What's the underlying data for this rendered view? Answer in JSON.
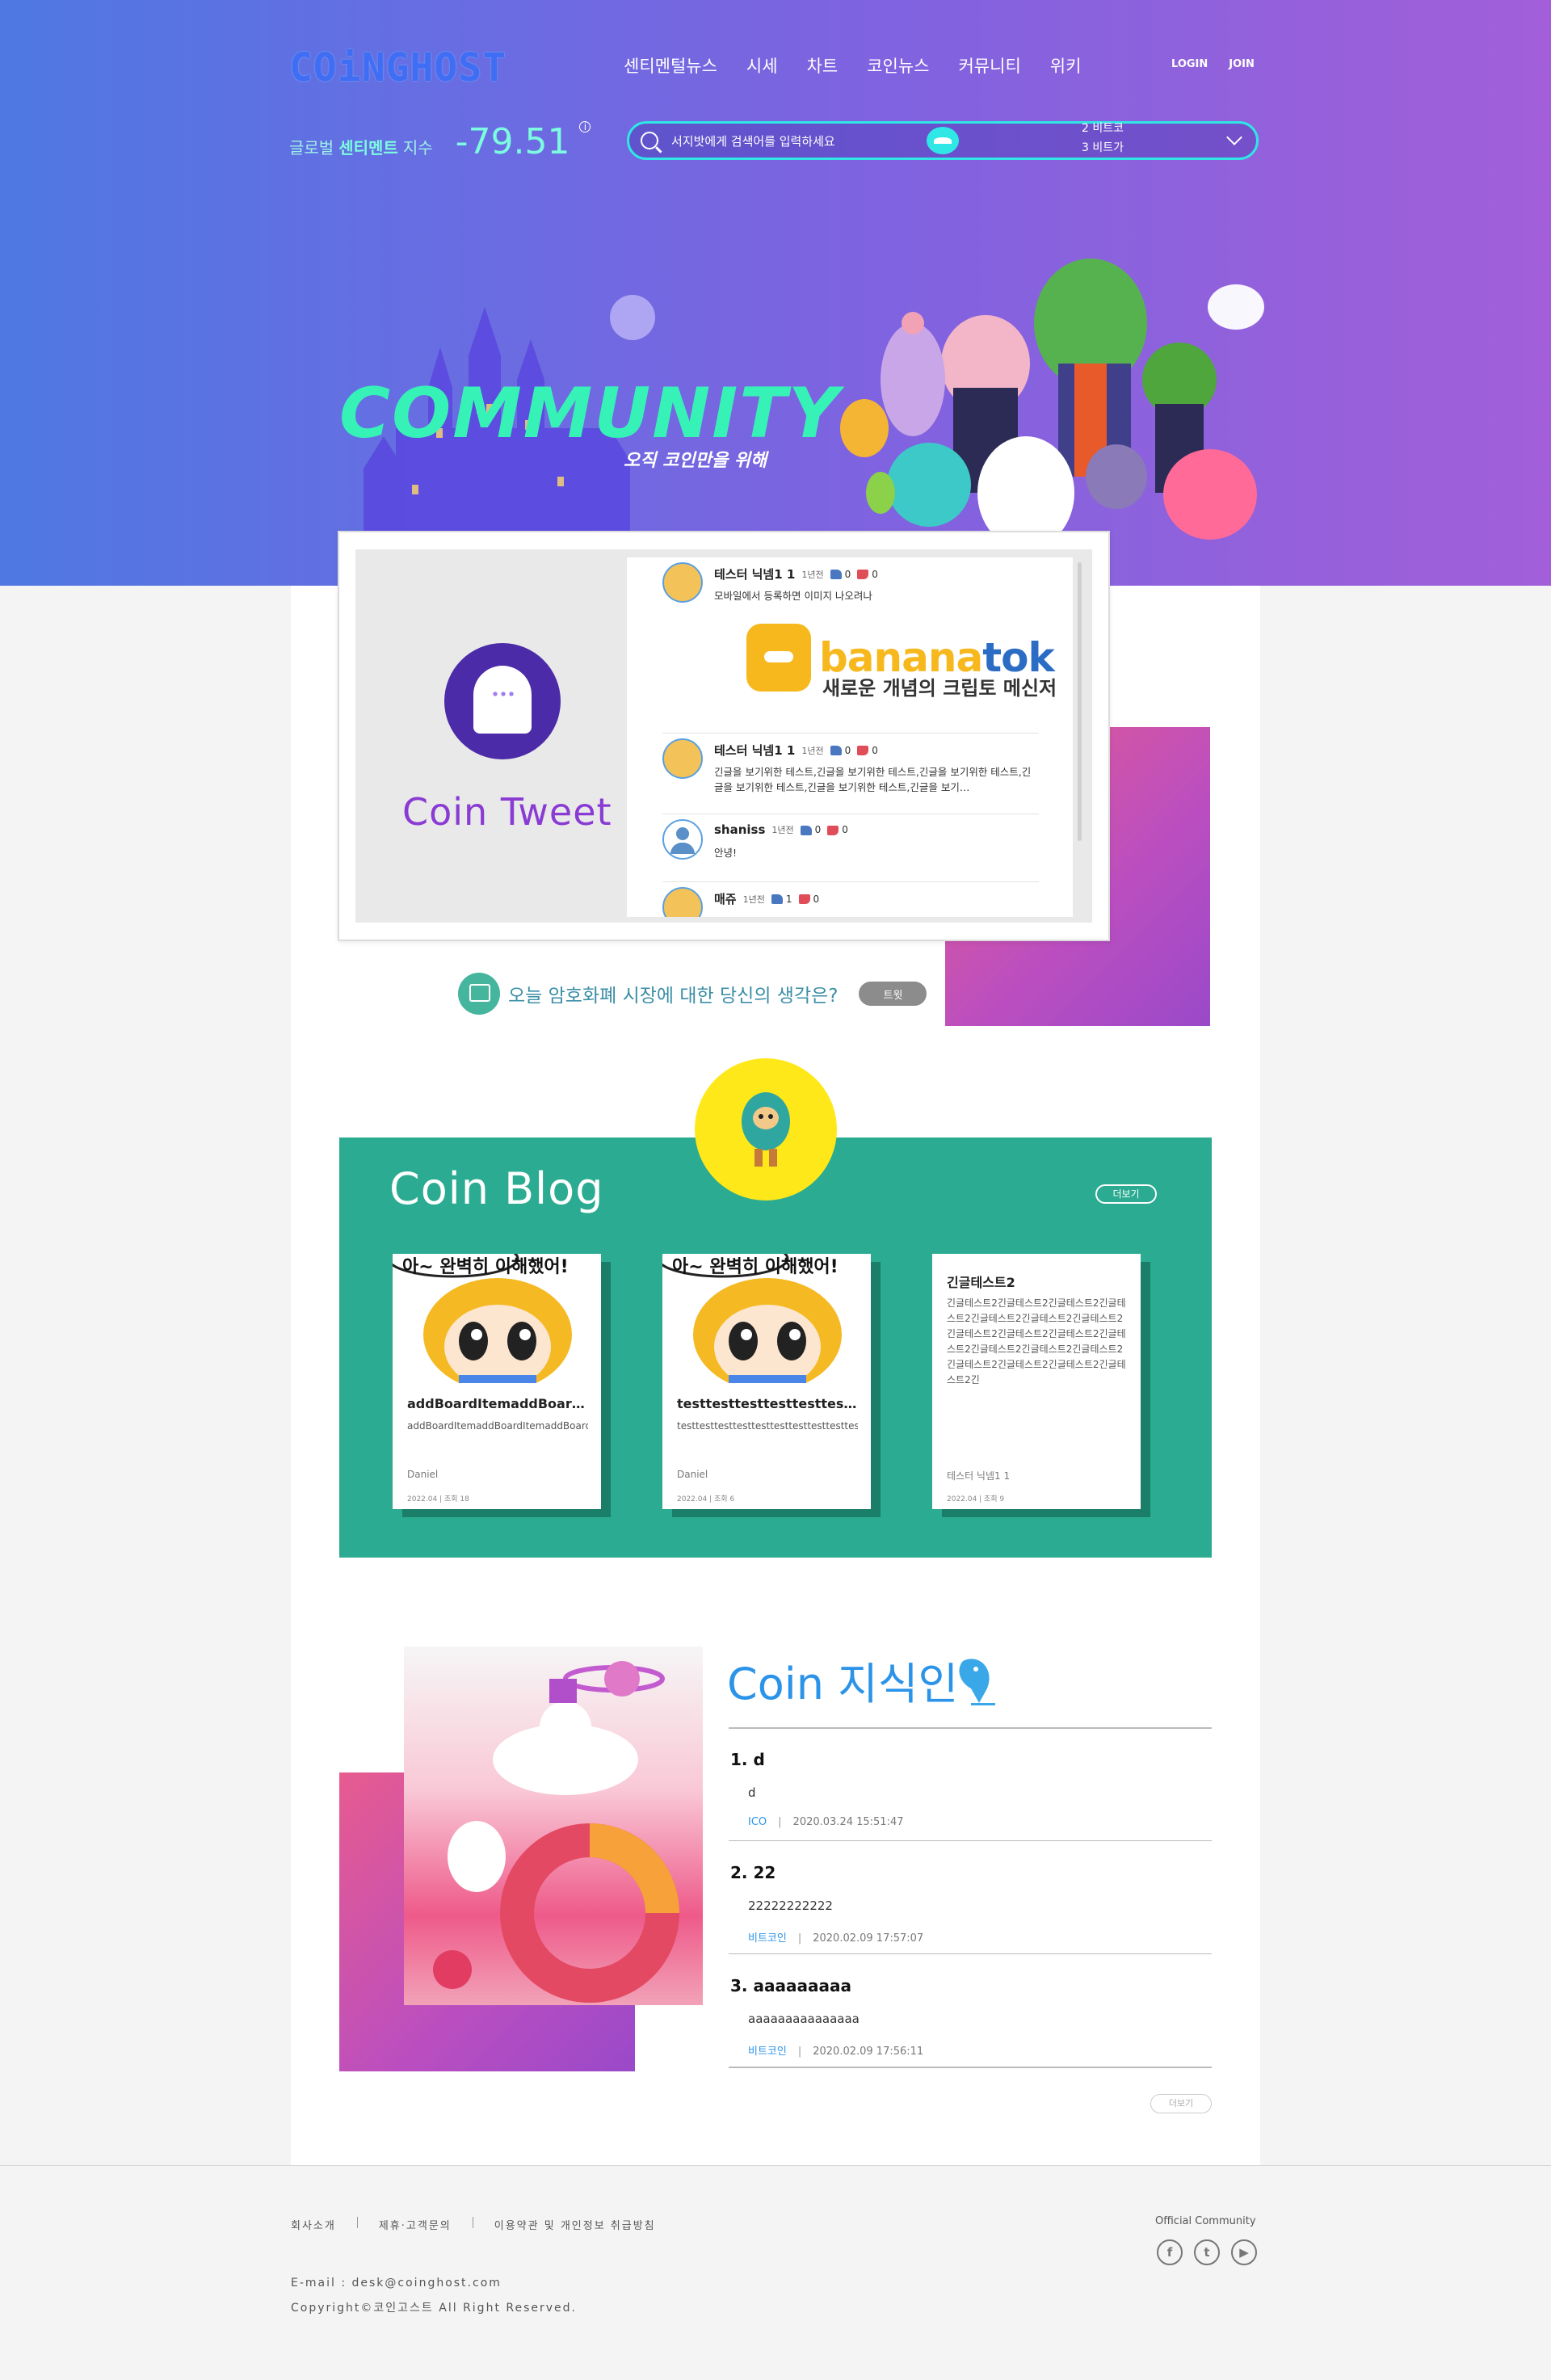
{
  "header": {
    "logo": "COiNGHOST",
    "nav": [
      "센티멘털뉴스",
      "시세",
      "차트",
      "코인뉴스",
      "커뮤니티",
      "위키"
    ],
    "login": "LOGIN",
    "join": "JOIN",
    "sentiment": {
      "label_pre": "글로벌",
      "label_bold": "센티멘트",
      "label_post": "지수",
      "value": "-79.51",
      "info": "i"
    },
    "search": {
      "placeholder": "서지밧에게 검색어를 입력하세요",
      "ranking": [
        "2  비트코",
        "3  비트가"
      ]
    }
  },
  "hero": {
    "title": "COMMUNITY",
    "subtitle": "오직 코인만을 위해"
  },
  "coin_tweet": {
    "title": "Coin Tweet",
    "posts": [
      {
        "nick": "테스터 닉넴1 1",
        "time": "1년전",
        "up": "0",
        "down": "0",
        "body": "모바일에서 등록하면 이미지 나오려나"
      },
      {
        "nick": "테스터 닉넴1 1",
        "time": "1년전",
        "up": "0",
        "down": "0",
        "body": "긴글을 보기위한 테스트,긴글을 보기위한 테스트,긴글을 보기위한 테스트,긴글을 보기위한 테스트,긴글을 보기위한 테스트,긴글을 보기…"
      },
      {
        "nick": "shaniss",
        "time": "1년전",
        "up": "0",
        "down": "0",
        "body": "안녕!"
      },
      {
        "nick": "매쥬",
        "time": "1년전",
        "up": "1",
        "down": "0",
        "body": ""
      }
    ],
    "banner": {
      "word_a": "banana",
      "word_b": "tok",
      "sub": "새로운 개념의 크립토 메신저"
    }
  },
  "ask": {
    "text": "오늘 암호화폐 시장에 대한 당신의 생각은?",
    "button": "트윗"
  },
  "coin_blog": {
    "title": "Coin Blog",
    "more": "더보기",
    "cards": [
      {
        "comic": "아~ 완벽히 이해했어!",
        "title": "addBoardItemaddBoardIte…",
        "desc": "addBoardItemaddBoardItemaddBoardItemaddBoardItemaddBoardItema…",
        "author": "Daniel",
        "stats": "2022.04  |  조회 18"
      },
      {
        "comic": "아~ 완벽히 이해했어!",
        "title": "testtesttesttesttesttestte…",
        "desc": "testtesttesttesttesttesttesttesttesttesttesttest",
        "author": "Daniel",
        "stats": "2022.04  |  조회 6"
      },
      {
        "title": "긴글테스트2",
        "desc": "긴글테스트2긴글테스트2긴글테스트2긴글테스트2긴글테스트2긴글테스트2긴글테스트2긴글테스트2긴글테스트2긴글테스트2긴글테스트2긴글테스트2긴글테스트2긴글테스트2긴글테스트2긴글테스트2긴글테스트2긴글테스트2긴",
        "author": "테스터 닉넴1 1",
        "stats": "2022.04  |  조회 9"
      }
    ]
  },
  "coin_knowledge": {
    "title": "Coin 지식인",
    "items": [
      {
        "q": "1. d",
        "a": "d",
        "cat": "ICO",
        "date": "2020.03.24 15:51:47"
      },
      {
        "q": "2. 22",
        "a": "22222222222",
        "cat": "비트코인",
        "date": "2020.02.09 17:57:07"
      },
      {
        "q": "3. aaaaaaaaa",
        "a": "aaaaaaaaaaaaaaa",
        "cat": "비트코인",
        "date": "2020.02.09 17:56:11"
      }
    ],
    "more": "더보기"
  },
  "footer": {
    "links": [
      "회사소개",
      "제휴·고객문의",
      "이용약관 및 개인정보 취급방침"
    ],
    "email": "E-mail : desk@coinghost.com",
    "copyright": "Copyright©코인고스트  All Right Reserved.",
    "official": "Official Community",
    "social": [
      "f",
      "t",
      "▶"
    ]
  },
  "colors": {
    "accent_teal": "#2bab91",
    "mint": "#37f2b7",
    "blue": "#2b93e8",
    "purple": "#8a3bd3",
    "pink": "#e75b8f"
  }
}
